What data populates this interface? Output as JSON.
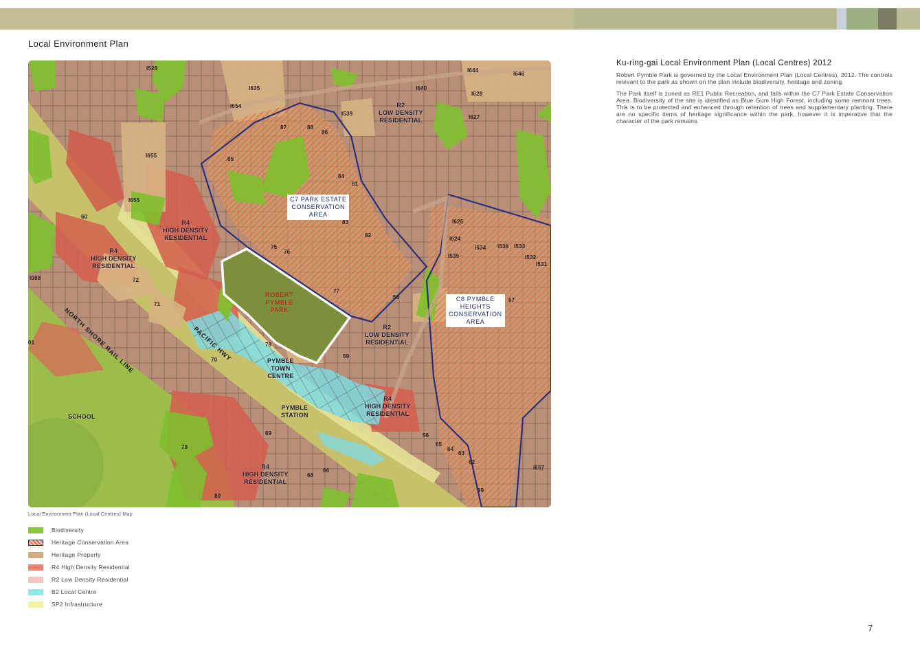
{
  "header": {
    "section_title": "Local Environment Plan",
    "band_colors": [
      "#c0bf93",
      "#b6b68f",
      "#c9d2dc",
      "#9fae82",
      "#7c7b64",
      "#bdbc98"
    ]
  },
  "map": {
    "caption": "Local Environment Plan (Local Centres) Map",
    "labels": {
      "c7": "C7 PARK ESTATE\nCONSERVATION\nAREA",
      "c8": "C8 PYMBLE\nHEIGHTS\nCONSERVATION\nAREA",
      "park": "ROBERT\nPYMBLE\nPARK",
      "r2_top": "R2\nLOW DENSITY\nRESIDENTIAL",
      "r2_mid": "R2\nLOW DENSITY\nRESIDENTIAL",
      "r4_a": "R4\nHIGH DENSITY\nRESIDENTIAL",
      "r4_b": "R4\nHIGH DENSITY\nRESIDENTIAL",
      "r4_c": "R4\nHIGH DENSITY\nRESIDENTIAL",
      "r4_d": "R4\nHIGH DENSITY\nRESIDENTIAL",
      "town_centre": "PYMBLE\nTOWN\nCENTRE",
      "station": "PYMBLE\nSTATION",
      "school": "SCHOOL",
      "rail": "NORTH SHORE RAIL LINE",
      "hwy": "PACIFIC HWY"
    },
    "lot_numbers": [
      {
        "t": "I528"
      },
      {
        "t": "I635"
      },
      {
        "t": "I654"
      },
      {
        "t": "I640"
      },
      {
        "t": "I644"
      },
      {
        "t": "I646"
      },
      {
        "t": "I628"
      },
      {
        "t": "I627"
      },
      {
        "t": "I539"
      },
      {
        "t": "87"
      },
      {
        "t": "88"
      },
      {
        "t": "86"
      },
      {
        "t": "85"
      },
      {
        "t": "I655"
      },
      {
        "t": "I655"
      },
      {
        "t": "84"
      },
      {
        "t": "61"
      },
      {
        "t": "60"
      },
      {
        "t": "83"
      },
      {
        "t": "82"
      },
      {
        "t": "I625"
      },
      {
        "t": "I624"
      },
      {
        "t": "I534"
      },
      {
        "t": "I536"
      },
      {
        "t": "I533"
      },
      {
        "t": "I532"
      },
      {
        "t": "I535"
      },
      {
        "t": "I531"
      },
      {
        "t": "75"
      },
      {
        "t": "76"
      },
      {
        "t": "72"
      },
      {
        "t": "71"
      },
      {
        "t": "77"
      },
      {
        "t": "58"
      },
      {
        "t": "67"
      },
      {
        "t": "I088"
      },
      {
        "t": "78"
      },
      {
        "t": "59"
      },
      {
        "t": "70"
      },
      {
        "t": "01"
      },
      {
        "t": "69"
      },
      {
        "t": "79"
      },
      {
        "t": "68"
      },
      {
        "t": "66"
      },
      {
        "t": "80"
      },
      {
        "t": "56"
      },
      {
        "t": "65"
      },
      {
        "t": "64"
      },
      {
        "t": "63"
      },
      {
        "t": "62"
      },
      {
        "t": "I657"
      },
      {
        "t": "39"
      }
    ]
  },
  "legend": [
    {
      "label": "Biodiversity",
      "color": "#8cc63f",
      "pattern": "solid"
    },
    {
      "label": "Heritage Conservation Area",
      "color": "#e07050",
      "pattern": "hatch"
    },
    {
      "label": "Heritage Property",
      "color": "#d3ad7f",
      "pattern": "solid"
    },
    {
      "label": "R4 High Density Residential",
      "color": "#e88370",
      "pattern": "solid"
    },
    {
      "label": "R2 Low Density Residential",
      "color": "#f5c5c2",
      "pattern": "solid"
    },
    {
      "label": "B2 Local Centre",
      "color": "#8fe7ea",
      "pattern": "solid"
    },
    {
      "label": "SP2 Infrastructure",
      "color": "#f4f4a0",
      "pattern": "solid"
    }
  ],
  "content": {
    "heading": "Ku-ring-gai Local Environment Plan (Local Centres) 2012",
    "paragraph1": "Robert Pymble Park is governed by the Local Environment Plan (Local Centres), 2012. The controls relevant to the park as shown on the plan include biodiversity, heritage and zoning.",
    "paragraph2": "The Park itself is zoned as RE1 Public Recreation, and falls within the C7 Park Estate Conservation Area. Biodiversity of the site is identified as Blue Gum High Forest, including some remnant trees. This is to be protected and enhanced through retention of trees and supplementary planting. There are no specific items of heritage significance within the park, however it is imperative that the character of the park remains."
  },
  "page_number": "7"
}
